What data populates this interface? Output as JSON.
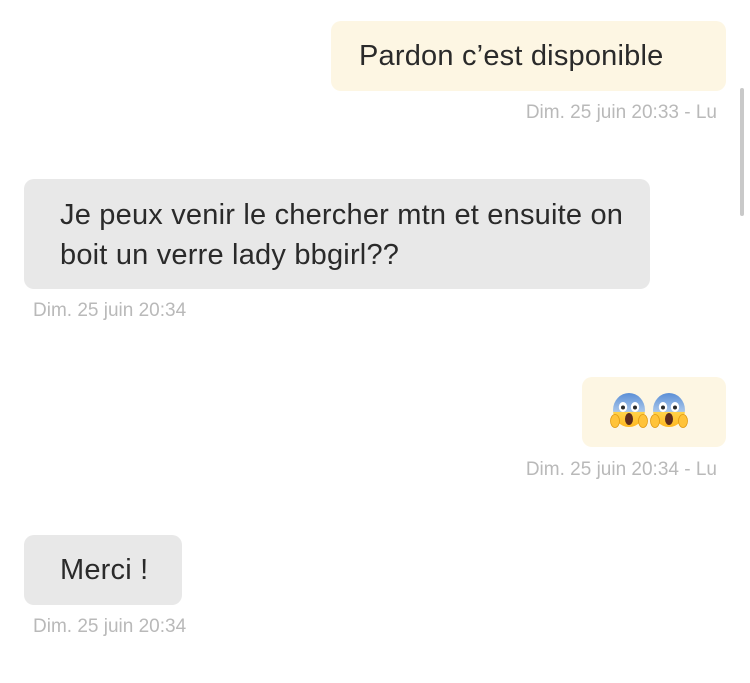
{
  "messages": [
    {
      "direction": "outgoing",
      "text": "Pardon c’est disponible",
      "meta": "Dim. 25 juin 20:33 - Lu"
    },
    {
      "direction": "incoming",
      "text": "Je peux venir le chercher mtn et ensuite on boit un verre lady bbgirl??",
      "meta": "Dim. 25 juin 20:34"
    },
    {
      "direction": "outgoing",
      "text": "😱😱",
      "icons": [
        "face-screaming-in-fear-icon",
        "face-screaming-in-fear-icon"
      ],
      "meta": "Dim. 25 juin 20:34 - Lu"
    },
    {
      "direction": "incoming",
      "text": "Merci !",
      "meta": "Dim. 25 juin 20:34"
    }
  ],
  "colors": {
    "outgoing_bubble": "#fdf6e3",
    "incoming_bubble": "#e8e8e8",
    "text": "#2a2a2a",
    "meta": "#b9b9b9"
  }
}
